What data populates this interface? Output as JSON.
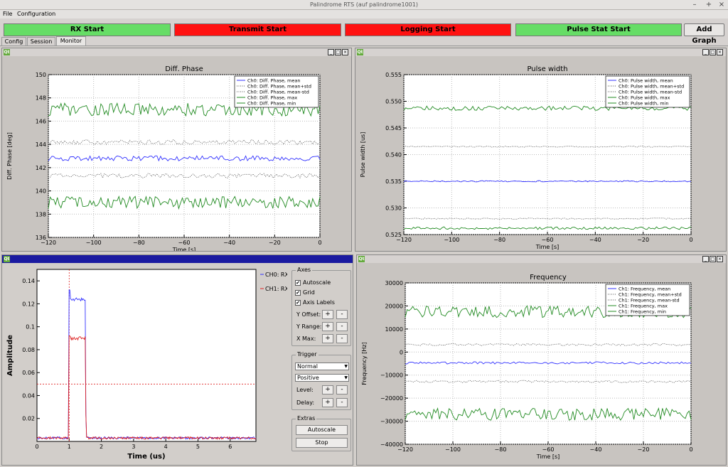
{
  "window": {
    "title": "Palindrome RTS (auf palindrome1001)",
    "controls": [
      "–",
      "+",
      "×"
    ]
  },
  "menu": [
    "File",
    "Configuration"
  ],
  "controls": [
    {
      "label": "RX Start",
      "state": "green"
    },
    {
      "label": "Transmit Start",
      "state": "red"
    },
    {
      "label": "Logging Start",
      "state": "red"
    },
    {
      "label": "Pulse Stat Start",
      "state": "green"
    }
  ],
  "add_graph_label": "Add Graph",
  "tabs": [
    "Config",
    "Session",
    "Monitor"
  ],
  "active_tab": "Monitor",
  "subwindow_badge": "Qt",
  "subwindow_buttons": [
    "_",
    "□",
    "×"
  ],
  "chart_data": [
    {
      "type": "line",
      "title": "Diff. Phase",
      "xlabel": "Time [s]",
      "ylabel": "Diff. Phase [deg]",
      "xlim": [
        -120,
        0
      ],
      "ylim": [
        136,
        150
      ],
      "xticks": [
        "−120",
        "−100",
        "−80",
        "−60",
        "−40",
        "−20",
        "0"
      ],
      "yticks": [
        "136",
        "138",
        "140",
        "142",
        "144",
        "146",
        "148",
        "150"
      ],
      "grid": true,
      "legend_position": "top-right",
      "series": [
        {
          "name": "Ch0: Diff. Phase, mean",
          "color": "#3333ff",
          "style": "solid",
          "level": 142.8,
          "noise": 0.22
        },
        {
          "name": "Ch0: Diff. Phase, mean+std",
          "color": "#555555",
          "style": "dotted",
          "level": 144.2,
          "noise": 0.2
        },
        {
          "name": "Ch0: Diff. Phase, mean-std",
          "color": "#555555",
          "style": "dotted",
          "level": 141.3,
          "noise": 0.2
        },
        {
          "name": "Ch0: Diff. Phase, max",
          "color": "#228b22",
          "style": "solid",
          "level": 147.0,
          "noise": 0.55
        },
        {
          "name": "Ch0: Diff. Phase, min",
          "color": "#228b22",
          "style": "solid",
          "level": 139.0,
          "noise": 0.55
        }
      ]
    },
    {
      "type": "line",
      "title": "Pulse width",
      "xlabel": "Time [s]",
      "ylabel": "Pulse width [us]",
      "xlim": [
        -120,
        0
      ],
      "ylim": [
        0.525,
        0.555
      ],
      "xticks": [
        "−120",
        "−100",
        "−80",
        "−60",
        "−40",
        "−20",
        "0"
      ],
      "yticks": [
        "0.525",
        "0.530",
        "0.535",
        "0.540",
        "0.545",
        "0.550",
        "0.555"
      ],
      "grid": true,
      "legend_position": "top-right",
      "series": [
        {
          "name": "Ch0: Pulse width, mean",
          "color": "#3333ff",
          "style": "solid",
          "level": 0.535,
          "noise": 0.00012
        },
        {
          "name": "Ch0: Pulse width, mean+std",
          "color": "#555555",
          "style": "dotted",
          "level": 0.5415,
          "noise": 0.00012
        },
        {
          "name": "Ch0: Pulse width, mean-std",
          "color": "#555555",
          "style": "dotted",
          "level": 0.528,
          "noise": 0.00012
        },
        {
          "name": "Ch0: Pulse width, max",
          "color": "#228b22",
          "style": "solid",
          "level": 0.5487,
          "noise": 0.0004
        },
        {
          "name": "Ch0: Pulse width, min",
          "color": "#228b22",
          "style": "solid",
          "level": 0.5262,
          "noise": 0.00025
        }
      ]
    },
    {
      "type": "line",
      "title": "",
      "xlabel": "Time (us)",
      "ylabel": "Amplitude",
      "xlim": [
        0,
        6.8
      ],
      "ylim": [
        0,
        0.15
      ],
      "xticks": [
        "0",
        "1",
        "2",
        "3",
        "4",
        "5",
        "6"
      ],
      "yticks": [
        "0.02",
        "0.04",
        "0.06",
        "0.08",
        "0.1",
        "0.12",
        "0.14"
      ],
      "grid": false,
      "legend_position": "right-outside",
      "markers": {
        "vertical_x": 1.0,
        "horizontal_y": 0.05
      },
      "series": [
        {
          "name": "CH0: RX",
          "color": "#3333ff",
          "pulse_start": 0.98,
          "pulse_end": 1.5,
          "peak": 0.132,
          "plateau": 0.124,
          "baseline": 0.003
        },
        {
          "name": "CH1: RX",
          "color": "#dd2222",
          "pulse_start": 0.98,
          "pulse_end": 1.5,
          "peak": 0.092,
          "plateau": 0.09,
          "baseline": 0.003
        }
      ]
    },
    {
      "type": "line",
      "title": "Frequency",
      "xlabel": "Time [s]",
      "ylabel": "Frequency [Hz]",
      "xlim": [
        -120,
        0
      ],
      "ylim": [
        -40000,
        30000
      ],
      "xticks": [
        "−120",
        "−100",
        "−80",
        "−60",
        "−40",
        "−20",
        "0"
      ],
      "yticks": [
        "−40000",
        "−30000",
        "−20000",
        "−10000",
        "0",
        "10000",
        "20000",
        "30000"
      ],
      "grid": true,
      "legend_position": "top-right",
      "series": [
        {
          "name": "Ch1: Frequency, mean",
          "color": "#3333ff",
          "style": "solid",
          "level": -4700,
          "noise": 500
        },
        {
          "name": "Ch1: Frequency, mean+std",
          "color": "#555555",
          "style": "dotted",
          "level": 3200,
          "noise": 500
        },
        {
          "name": "Ch1: Frequency, mean-std",
          "color": "#555555",
          "style": "dotted",
          "level": -12800,
          "noise": 500
        },
        {
          "name": "Ch1: Frequency, max",
          "color": "#228b22",
          "style": "solid",
          "level": 17500,
          "noise": 2600
        },
        {
          "name": "Ch1: Frequency, min",
          "color": "#228b22",
          "style": "solid",
          "level": -27000,
          "noise": 2600
        }
      ]
    }
  ],
  "scope_panel": {
    "axes": {
      "title": "Axes",
      "autoscale": "Autoscale",
      "grid": "Grid",
      "axis_labels": "Axis Labels",
      "y_offset": "Y Offset:",
      "y_range": "Y Range:",
      "x_max": "X Max:",
      "checked": "✔"
    },
    "plus": "+",
    "minus": "-",
    "trigger": {
      "title": "Trigger",
      "mode": "Normal",
      "slope": "Positive",
      "level": "Level:",
      "delay": "Delay:"
    },
    "extras": {
      "title": "Extras",
      "autoscale_btn": "Autoscale",
      "stop_btn": "Stop"
    },
    "dropdown_arrow": "▼"
  }
}
